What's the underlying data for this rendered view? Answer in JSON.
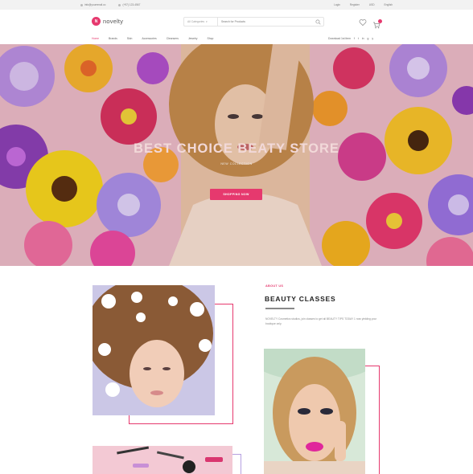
{
  "topbar": {
    "email": "info@youremail.co",
    "phone": "(+97) 123-4567",
    "links": [
      "Login",
      "Register",
      "USD",
      "English"
    ]
  },
  "header": {
    "logo_text": "novelty",
    "logo_mark": "N",
    "search_category": "All Categories",
    "search_placeholder": "Search for Products"
  },
  "nav": {
    "items": [
      "Home",
      "Brands",
      "Skin",
      "Accessories",
      "Cleansers",
      "Jewelry",
      "Shop"
    ],
    "active": 0,
    "right_text": "Download 1st item",
    "right_social": [
      "f",
      "t",
      "in",
      "g",
      "y"
    ]
  },
  "hero": {
    "title": "BEST CHOICE BEATY STORE",
    "subtitle": "NEW COLLECTION",
    "button": "SHOPPING NOW"
  },
  "about": {
    "label": "ABOUT US",
    "title": "BEAUTY CLASSES",
    "text": "NOVELTY Cosmetics studios, join classes to get all BEAUTY TIPS TODAY 1 now yielding your boutique only."
  },
  "colors": {
    "accent": "#e6396e",
    "topbar": "#f2f2f2"
  }
}
